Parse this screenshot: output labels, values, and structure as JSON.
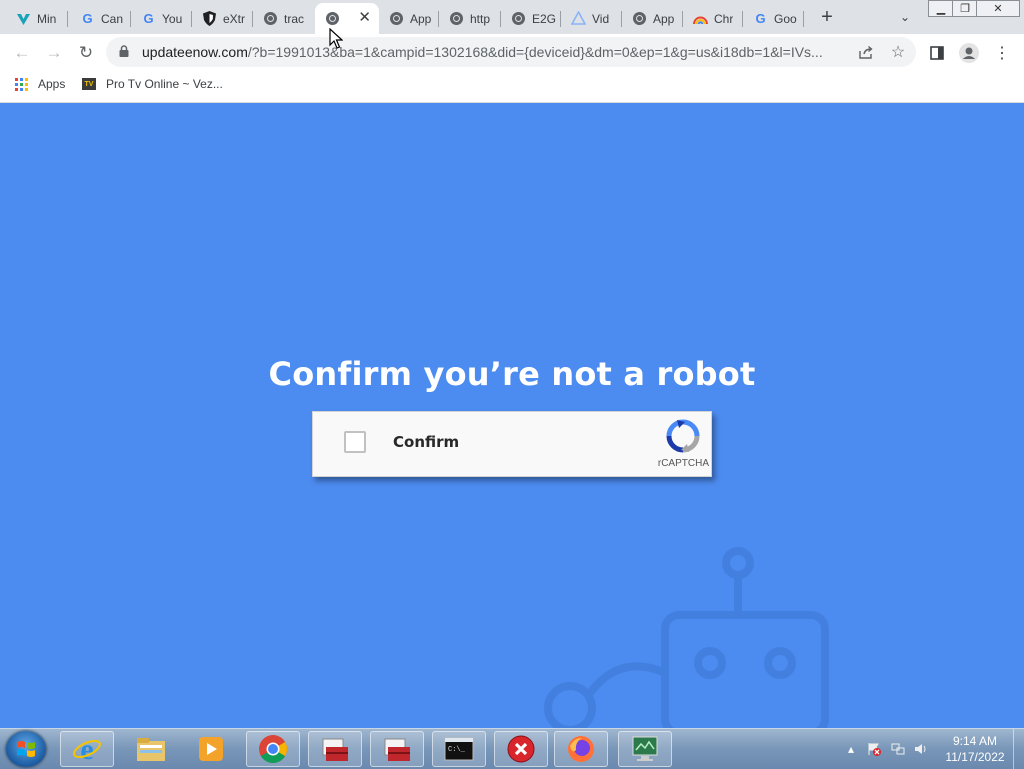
{
  "browser": {
    "tabs": [
      {
        "title": "Min",
        "icon": "vpn-shield-icon"
      },
      {
        "title": "Can",
        "icon": "google-icon"
      },
      {
        "title": "You",
        "icon": "google-icon"
      },
      {
        "title": "eXtr",
        "icon": "shield-icon"
      },
      {
        "title": "trac",
        "icon": "globe-icon"
      },
      {
        "title": "",
        "icon": "globe-icon",
        "active": true
      },
      {
        "title": "App",
        "icon": "globe-icon"
      },
      {
        "title": "http",
        "icon": "globe-icon"
      },
      {
        "title": "E2G",
        "icon": "globe-icon"
      },
      {
        "title": "Vid",
        "icon": "triangle-icon"
      },
      {
        "title": "App",
        "icon": "globe-icon"
      },
      {
        "title": "Chr",
        "icon": "rainbow-icon"
      },
      {
        "title": "Goo",
        "icon": "google-icon"
      }
    ],
    "new_tab": "+",
    "url_host": "updateenow.com",
    "url_rest": "/?b=1991013&ba=1&campid=1302168&did={deviceid}&dm=0&ep=1&g=us&i18db=1&l=IVs...",
    "bookmarks": [
      {
        "label": "Apps",
        "icon": "apps-grid-icon"
      },
      {
        "label": "Pro Tv Online ~ Vez...",
        "icon": "tv-icon"
      }
    ]
  },
  "page": {
    "heading": "Confirm you’re not a robot",
    "captcha": {
      "checkbox_label": "Confirm",
      "brand": "rCAPTCHA"
    }
  },
  "taskbar": {
    "time": "9:14 AM",
    "date": "11/17/2022",
    "items": [
      "internet-explorer-icon",
      "file-explorer-icon",
      "media-player-icon",
      "chrome-icon",
      "toolbox-icon",
      "toolbox-icon",
      "command-prompt-icon",
      "error-icon",
      "firefox-icon",
      "monitor-icon"
    ]
  }
}
